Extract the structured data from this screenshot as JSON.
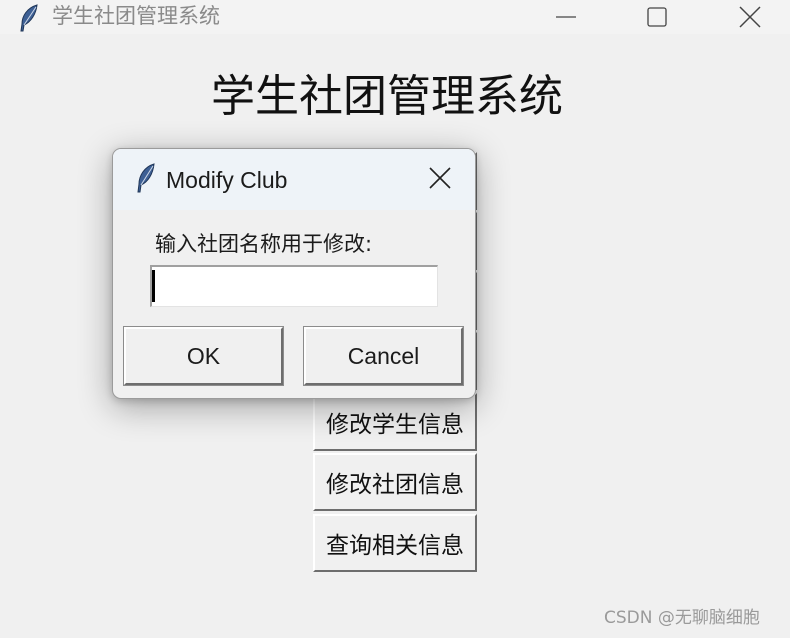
{
  "window": {
    "title": "学生社团管理系统",
    "icon": "feather-icon"
  },
  "main": {
    "heading": "学生社团管理系统",
    "buttons": [
      {
        "label": ""
      },
      {
        "label": ""
      },
      {
        "label": ""
      },
      {
        "label": ""
      },
      {
        "label": "修改学生信息"
      },
      {
        "label": "修改社团信息"
      },
      {
        "label": "查询相关信息"
      }
    ]
  },
  "dialog": {
    "title": "Modify Club",
    "prompt": "输入社团名称用于修改:",
    "entry_value": "",
    "ok_label": "OK",
    "cancel_label": "Cancel"
  },
  "watermark": "CSDN @无聊脑细胞",
  "colors": {
    "background": "#f0f0f0",
    "dialog_titlebar": "#eef3f8",
    "feather_blue": "#4a6fa5"
  }
}
